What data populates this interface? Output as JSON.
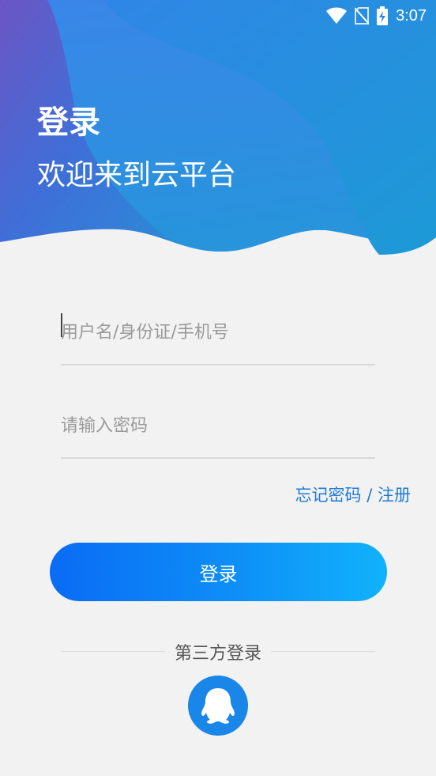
{
  "status_bar": {
    "time": "3:07",
    "icons": [
      "wifi-icon",
      "no-sim-icon",
      "battery-charging-icon"
    ]
  },
  "header": {
    "title": "登录",
    "subtitle": "欢迎来到云平台"
  },
  "form": {
    "username_placeholder": "用户名/身份证/手机号",
    "username_value": "",
    "password_placeholder": "请输入密码",
    "password_value": ""
  },
  "links": {
    "forgot": "忘记密码",
    "separator": " / ",
    "register": "注册"
  },
  "login_button": "登录",
  "third_party": {
    "label": "第三方登录",
    "providers": [
      "qq-icon"
    ]
  },
  "colors": {
    "accent": "#0a6cf5",
    "link": "#1e7bd6",
    "qq": "#1a86e8"
  }
}
